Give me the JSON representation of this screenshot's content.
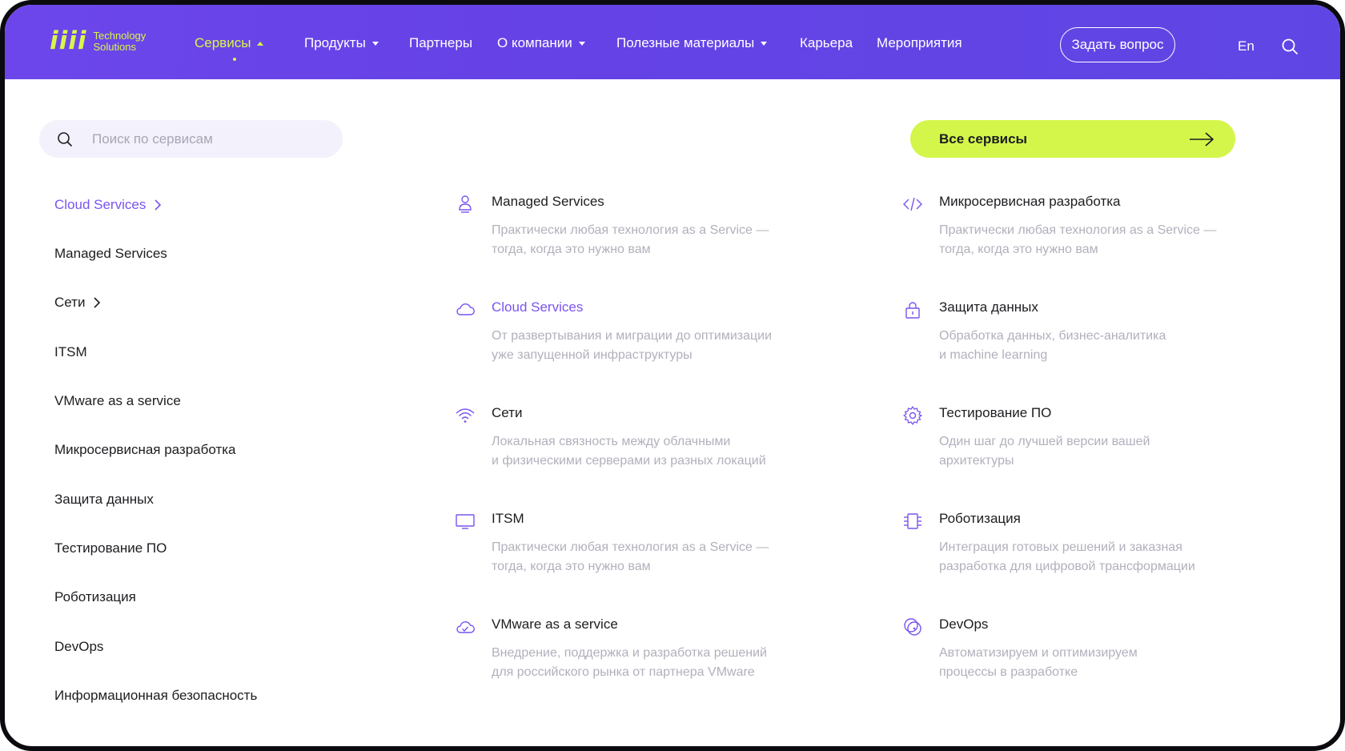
{
  "brand": {
    "mark": "iiii",
    "line1": "Technology",
    "line2": "Solutions"
  },
  "nav": {
    "items": [
      {
        "label": "Сервисы",
        "active": true
      },
      {
        "label": "Продукты"
      },
      {
        "label": "Партнеры"
      },
      {
        "label": "О компании"
      },
      {
        "label": "Полезные материалы"
      },
      {
        "label": "Карьера"
      },
      {
        "label": "Мероприятия"
      }
    ],
    "ask_label": "Задать вопрос",
    "lang_label": "En"
  },
  "search": {
    "placeholder": "Поиск по сервисам"
  },
  "all_services_label": "Все сервисы",
  "sidebar": {
    "items": [
      {
        "label": "Cloud Services",
        "has_arrow": true,
        "active": true
      },
      {
        "label": "Managed Services"
      },
      {
        "label": "Сети",
        "has_arrow": true
      },
      {
        "label": "ITSM"
      },
      {
        "label": "VMware as a service"
      },
      {
        "label": "Микросервисная разработка"
      },
      {
        "label": "Защита данных"
      },
      {
        "label": "Тестирование ПО"
      },
      {
        "label": "Роботизация"
      },
      {
        "label": "DevOps"
      },
      {
        "label": "Информационная безопасность"
      }
    ]
  },
  "services": {
    "col1": [
      {
        "title": "Managed Services",
        "desc": "Практически любая технология as a Service —\nтогда, когда это нужно вам",
        "icon": "person-icon"
      },
      {
        "title": "Cloud Services",
        "desc": "От развертывания и миграции до оптимизации\nуже запущенной инфраструктуры",
        "icon": "cloud-icon",
        "active": true
      },
      {
        "title": "Сети",
        "desc": "Локальная связность между облачными\nи физическими серверами из разных локаций",
        "icon": "wifi-icon"
      },
      {
        "title": "ITSM",
        "desc": "Практически любая технология as a Service —\nтогда, когда это нужно вам",
        "icon": "monitor-icon"
      },
      {
        "title": "VMware as a service",
        "desc": "Внедрение, поддержка и разработка решений\nдля российского рынка от партнера VMware",
        "icon": "cloud-check-icon"
      }
    ],
    "col2": [
      {
        "title": "Микросервисная разработка",
        "desc": "Практически любая технология as a Service —\nтогда, когда это нужно вам",
        "icon": "code-icon"
      },
      {
        "title": "Защита данных",
        "desc": "Обработка данных, бизнес-аналитика\nи machine learning",
        "icon": "lock-icon"
      },
      {
        "title": "Тестирование ПО",
        "desc": "Один шаг до лучшей версии вашей\nархитектуры",
        "icon": "gear-icon"
      },
      {
        "title": "Роботизация",
        "desc": "Интеграция готовых решений и заказная\nразработка для цифровой трансформации",
        "icon": "chip-icon"
      },
      {
        "title": "DevOps",
        "desc": "Автоматизируем и оптимизируем\nпроцессы в разработке",
        "icon": "devops-icon"
      }
    ]
  },
  "colors": {
    "header_bg": "#6542e6",
    "accent_lime": "#d4f64a",
    "accent_purple": "#7a54ef",
    "text_dark": "#1d1d21",
    "text_muted": "#b2b0bc"
  }
}
